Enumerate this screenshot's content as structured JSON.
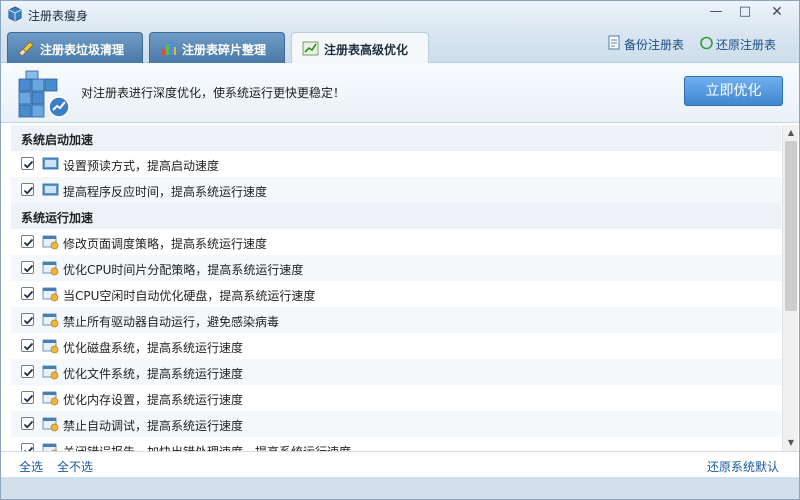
{
  "window": {
    "title": "注册表瘦身"
  },
  "tabs": [
    {
      "label": "注册表垃圾清理"
    },
    {
      "label": "注册表碎片整理"
    },
    {
      "label": "注册表高级优化"
    }
  ],
  "toolbar": {
    "backup_label": "备份注册表",
    "restore_label": "还原注册表"
  },
  "header": {
    "description": "对注册表进行深度优化，使系统运行更快更稳定！",
    "optimize_button": "立即优化"
  },
  "groups": [
    {
      "title": "系统启动加速",
      "items": [
        {
          "label": "设置预读方式，提高启动速度",
          "checked": true
        },
        {
          "label": "提高程序反应时间，提高系统运行速度",
          "checked": true
        }
      ]
    },
    {
      "title": "系统运行加速",
      "items": [
        {
          "label": "修改页面调度策略，提高系统运行速度",
          "checked": true
        },
        {
          "label": "优化CPU时间片分配策略，提高系统运行速度",
          "checked": true
        },
        {
          "label": "当CPU空闲时自动优化硬盘，提高系统运行速度",
          "checked": true
        },
        {
          "label": "禁止所有驱动器自动运行，避免感染病毒",
          "checked": true
        },
        {
          "label": "优化磁盘系统，提高系统运行速度",
          "checked": true
        },
        {
          "label": "优化文件系统，提高系统运行速度",
          "checked": true
        },
        {
          "label": "优化内存设置，提高系统运行速度",
          "checked": true
        },
        {
          "label": "禁止自动调试，提高系统运行速度",
          "checked": true
        },
        {
          "label": "关闭错误报告，加快出错处理速度，提高系统运行速度",
          "checked": true
        }
      ]
    }
  ],
  "footer": {
    "select_all": "全选",
    "select_none": "全不选",
    "restore_default": "还原系统默认"
  }
}
